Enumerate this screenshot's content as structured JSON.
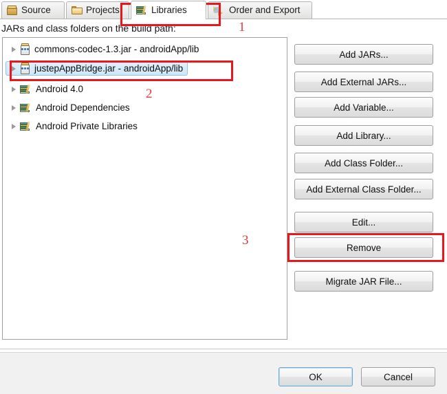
{
  "tabs": [
    {
      "id": "source",
      "label": "Source",
      "icon": "package-icon",
      "active": false
    },
    {
      "id": "projects",
      "label": "Projects",
      "icon": "folder-icon",
      "active": false
    },
    {
      "id": "libraries",
      "label": "Libraries",
      "icon": "books-icon",
      "active": true
    },
    {
      "id": "order",
      "label": "Order and Export",
      "icon": "order-export-icon",
      "active": false
    }
  ],
  "list": {
    "caption": "JARs and class folders on the build path:",
    "items": [
      {
        "label": "commons-codec-1.3.jar - androidApp/lib",
        "icon": "jar-icon",
        "selected": false
      },
      {
        "label": "justepAppBridge.jar - androidApp/lib",
        "icon": "jar-icon",
        "selected": true
      },
      {
        "label": "Android 4.0",
        "icon": "library-icon",
        "selected": false
      },
      {
        "label": "Android Dependencies",
        "icon": "library-icon",
        "selected": false
      },
      {
        "label": "Android Private Libraries",
        "icon": "library-icon",
        "selected": false
      }
    ]
  },
  "side_buttons": [
    {
      "id": "add-jars",
      "label": "Add JARs..."
    },
    {
      "id": "add-external-jars",
      "label": "Add External JARs..."
    },
    {
      "id": "add-variable",
      "label": "Add Variable..."
    },
    {
      "id": "add-library",
      "label": "Add Library..."
    },
    {
      "id": "add-class-folder",
      "label": "Add Class Folder..."
    },
    {
      "id": "add-ext-class-folder",
      "label": "Add External Class Folder..."
    },
    {
      "id": "edit",
      "label": "Edit..."
    },
    {
      "id": "remove",
      "label": "Remove"
    },
    {
      "id": "migrate-jar-file",
      "label": "Migrate JAR File..."
    }
  ],
  "footer": {
    "ok_label": "OK",
    "cancel_label": "Cancel"
  },
  "annotations": {
    "color": "#e8171b",
    "numbers": [
      {
        "id": "1",
        "text": "1",
        "target": "libraries-tab"
      },
      {
        "id": "2",
        "text": "2",
        "target": "selected-jar-row"
      },
      {
        "id": "3",
        "text": "3",
        "target": "remove-button"
      }
    ]
  }
}
